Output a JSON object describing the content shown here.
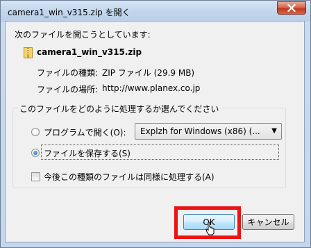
{
  "window": {
    "title": "camera1_win_v315.zip を開く",
    "close_icon": "close-icon"
  },
  "dialog": {
    "intro": "次のファイルを開こうとしています:",
    "file_name": "camera1_win_v315.zip",
    "type_label": "ファイルの種類:",
    "type_value": "ZIP ファイル (29.9 MB)",
    "location_label": "ファイルの場所:",
    "location_value": "http://www.planex.co.jp",
    "group_title": "このファイルをどのように処理するか選んでください",
    "open_with_label": "プログラムで開く(O):",
    "open_with_value": "Explzh for Windows (x86) (...",
    "save_label": "ファイルを保存する(S)",
    "remember_label": "今後この種類のファイルは同様に処理する(A)"
  },
  "state": {
    "selected_option": "save",
    "remember_checked": false
  },
  "buttons": {
    "ok": "OK",
    "cancel": "キャンセル"
  },
  "colors": {
    "highlight": "#ee1111",
    "close_button": "#c2391b"
  }
}
